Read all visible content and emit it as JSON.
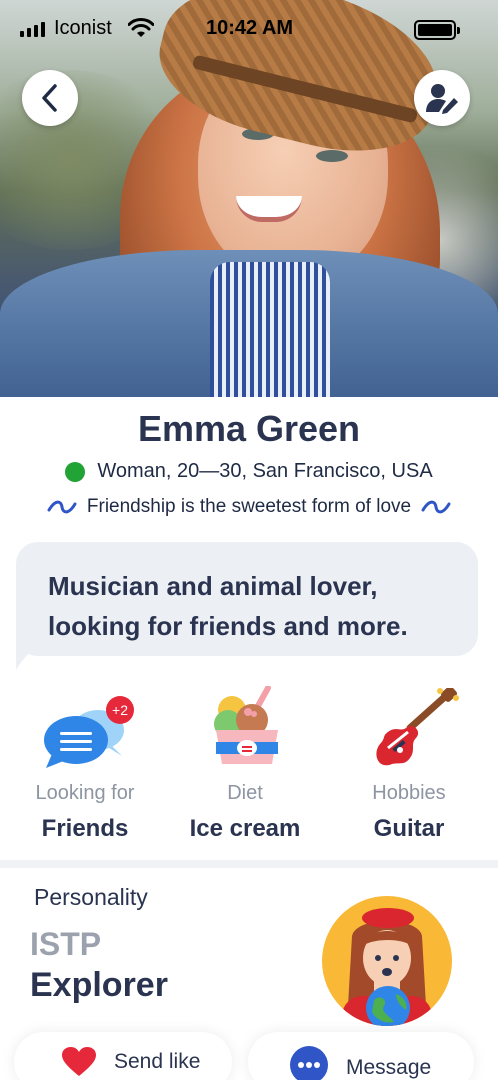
{
  "status_bar": {
    "carrier": "Iconist",
    "time": "10:42 AM"
  },
  "icons": {
    "back": "chevron-left-icon",
    "edit": "user-edit-icon",
    "online": "online-dot",
    "looking_for": "chat-bubbles-icon",
    "diet": "ice-cream-icon",
    "hobbies": "guitar-icon",
    "like": "heart-icon",
    "message": "chat-dots-icon"
  },
  "profile": {
    "name": "Emma Green",
    "meta": "Woman, 20—30, San Francisco, USA",
    "tagline": "Friendship is the sweetest form of love",
    "bio": "Musician and animal lover, looking for friends and more."
  },
  "features": [
    {
      "label": "Looking for",
      "value": "Friends",
      "badge": "+2"
    },
    {
      "label": "Diet",
      "value": "Ice cream"
    },
    {
      "label": "Hobbies",
      "value": "Guitar"
    }
  ],
  "personality": {
    "title": "Personality",
    "code": "ISTP",
    "type": "Explorer"
  },
  "actions": {
    "like_label": "Send like",
    "message_label": "Message"
  },
  "colors": {
    "accent_blue": "#2f55c6",
    "online_green": "#21a336",
    "heart_red": "#e6283b",
    "text_dark": "#2a3450",
    "text_muted": "#8d95a3"
  }
}
